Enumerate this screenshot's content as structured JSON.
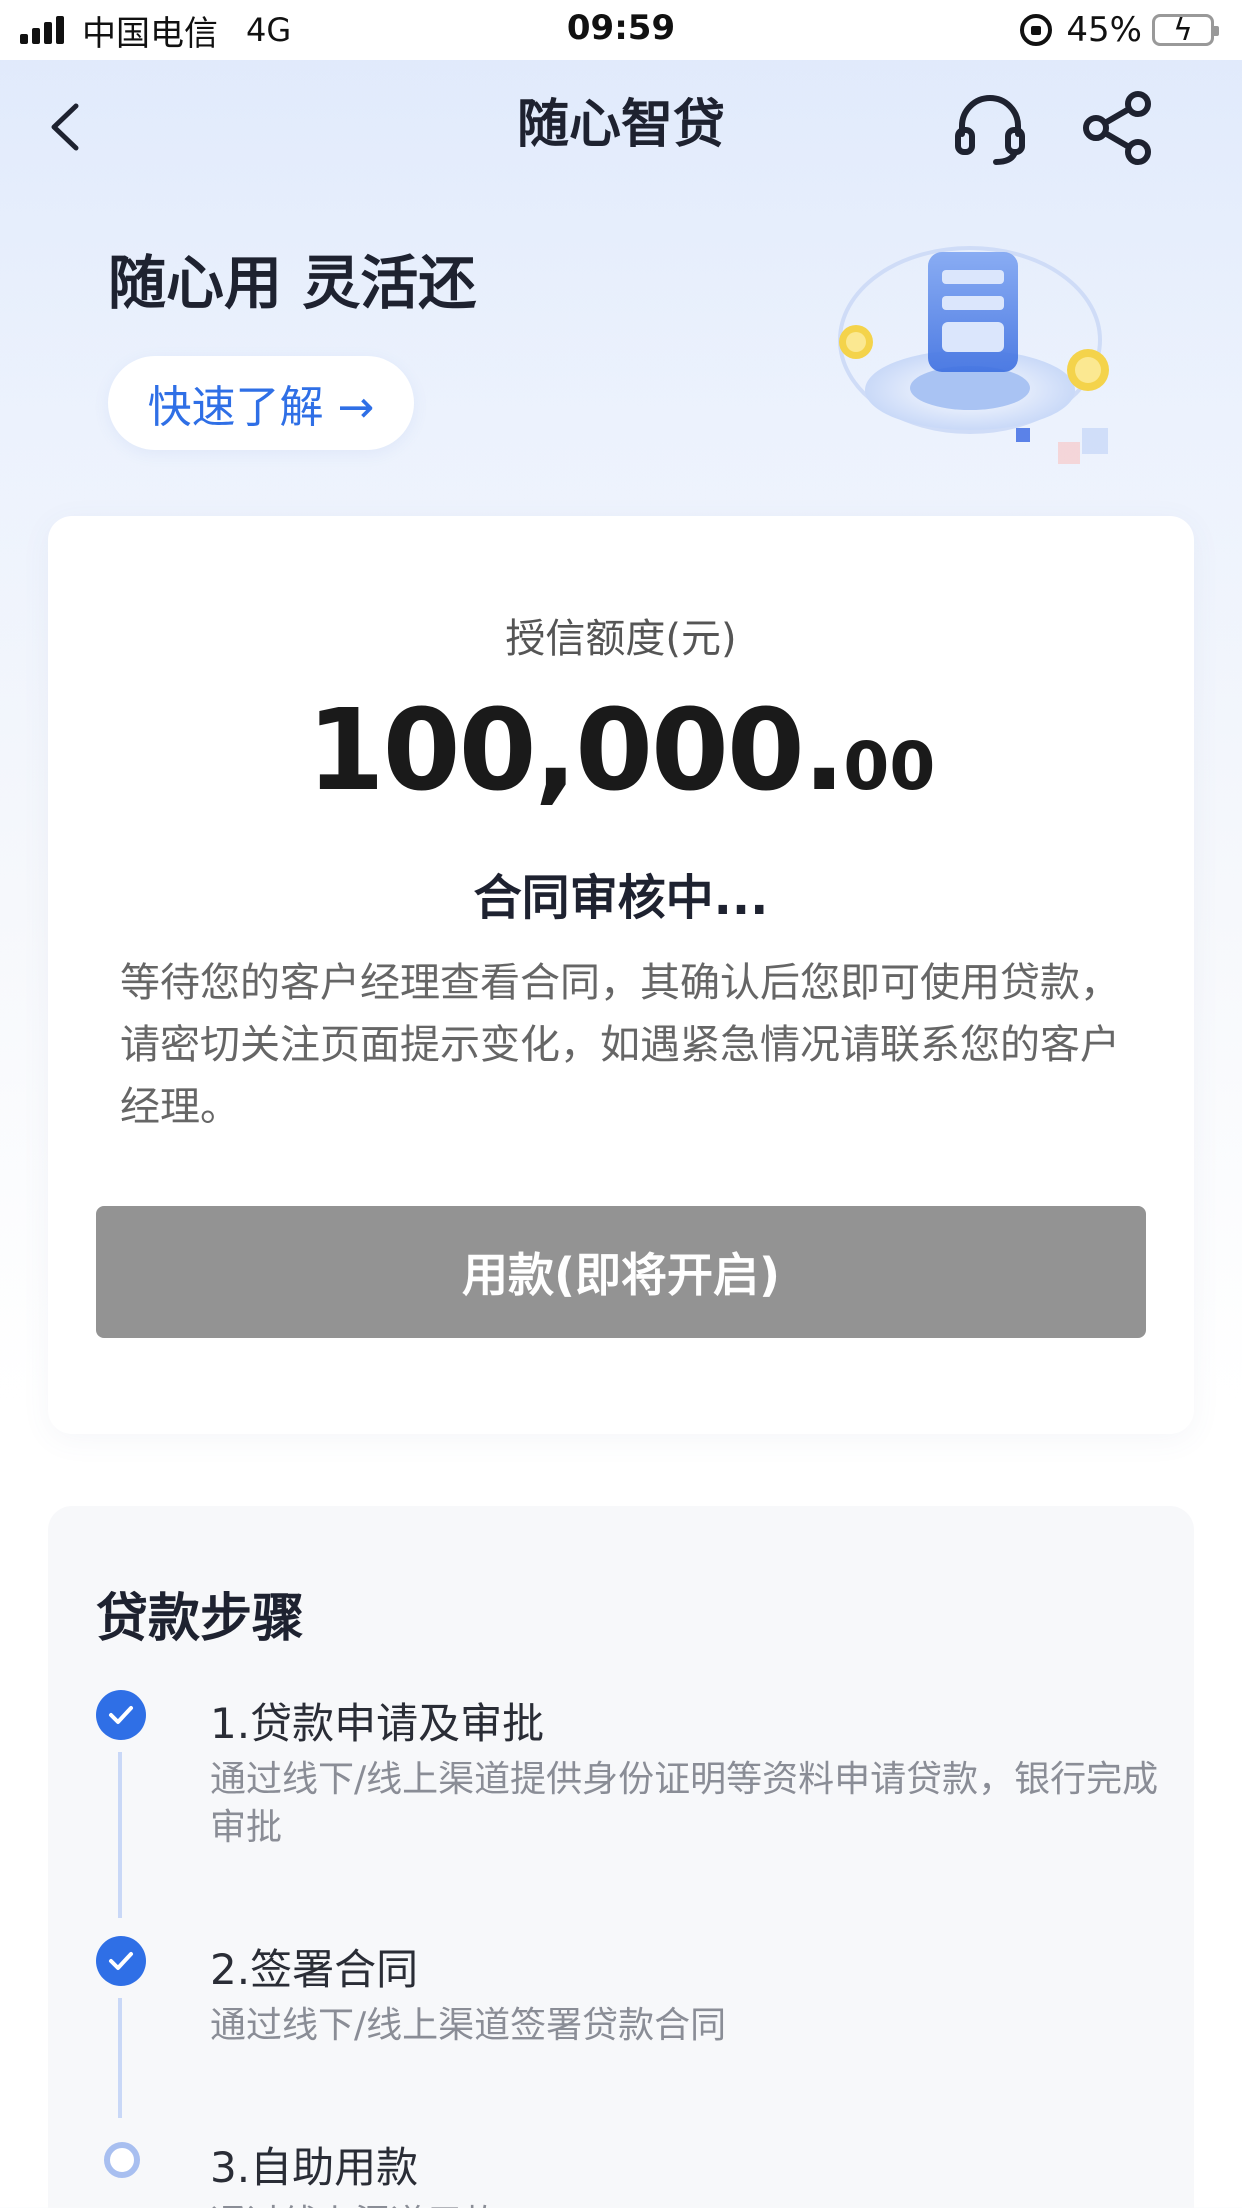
{
  "status_bar": {
    "carrier": "中国电信",
    "network": "4G",
    "time": "09:59",
    "battery": "45%",
    "battery_level": 0.45
  },
  "nav": {
    "title": "随心智贷",
    "icons": [
      "back-icon",
      "headset-icon",
      "share-icon"
    ]
  },
  "hero": {
    "title": "随心用 灵活还",
    "quick_button": "快速了解 →"
  },
  "credit": {
    "label": "授信额度(元)",
    "amount_int": "100,000.",
    "amount_dec": "00",
    "status_title": "合同审核中...",
    "status_desc": "等待您的客户经理查看合同，其确认后您即可使用贷款，请密切关注页面提示变化，如遇紧急情况请联系您的客户经理。",
    "use_button": "用款(即将开启)"
  },
  "steps": {
    "title": "贷款步骤",
    "items": [
      {
        "name": "1.贷款申请及审批",
        "desc": "通过线下/线上渠道提供身份证明等资料申请贷款，银行完成审批",
        "done": true
      },
      {
        "name": "2.签署合同",
        "desc": "通过线下/线上渠道签署贷款合同",
        "done": true
      },
      {
        "name": "3.自助用款",
        "desc": "通过线上渠道用款",
        "done": false
      }
    ]
  },
  "colors": {
    "accent": "#2f6fe6",
    "button_disabled": "#939393",
    "step_line": "#c9d8f7"
  }
}
